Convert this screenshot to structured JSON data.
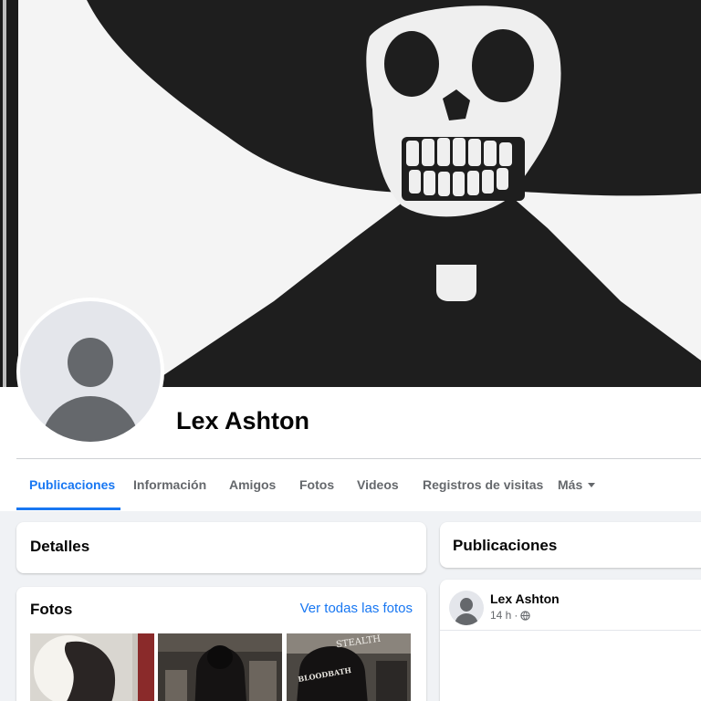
{
  "profile": {
    "name": "Lex Ashton"
  },
  "tabs": [
    {
      "label": "Publicaciones",
      "active": true
    },
    {
      "label": "Información",
      "active": false
    },
    {
      "label": "Amigos",
      "active": false
    },
    {
      "label": "Fotos",
      "active": false
    },
    {
      "label": "Videos",
      "active": false
    },
    {
      "label": "Registros de visitas",
      "active": false
    },
    {
      "label": "Más",
      "active": false
    }
  ],
  "details": {
    "title": "Detalles"
  },
  "photos": {
    "title": "Fotos",
    "see_all": "Ver todas las fotos",
    "thumb_texts": [
      "STEALTH",
      "BLOODBATH"
    ]
  },
  "posts": {
    "title": "Publicaciones",
    "post": {
      "author": "Lex Ashton",
      "time": "14 h",
      "privacy_icon": "globe-icon"
    }
  },
  "colors": {
    "accent": "#1877f2",
    "muted_text": "#65686c",
    "background": "#f0f2f5"
  },
  "icons": {
    "more_caret": "chevron-down-icon",
    "privacy": "globe-icon"
  }
}
